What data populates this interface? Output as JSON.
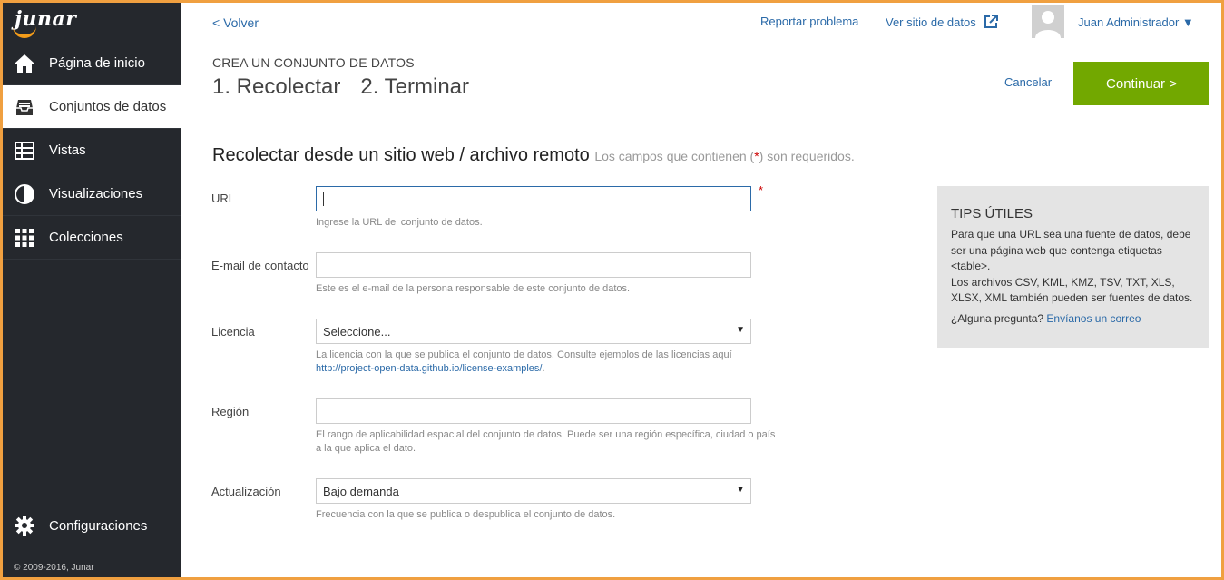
{
  "sidebar": {
    "logo": "junar",
    "items": [
      {
        "label": "Página de inicio",
        "icon": "home-icon"
      },
      {
        "label": "Conjuntos de datos",
        "icon": "inbox-icon"
      },
      {
        "label": "Vistas",
        "icon": "table-icon"
      },
      {
        "label": "Visualizaciones",
        "icon": "pie-chart-icon"
      },
      {
        "label": "Colecciones",
        "icon": "grid-icon"
      }
    ],
    "settings_label": "Configuraciones",
    "copyright": "© 2009-2016, Junar"
  },
  "header": {
    "back": "< Volver",
    "report": "Reportar problema",
    "view_site": "Ver sitio de datos",
    "user": "Juan Administrador ▼"
  },
  "wizard": {
    "subtitle": "CREA UN CONJUNTO DE DATOS",
    "step1": "1. Recolectar",
    "step2": "2. Terminar",
    "cancel": "Cancelar",
    "continue": "Continuar >"
  },
  "form": {
    "title": "Recolectar desde un sitio web / archivo remoto",
    "note_pre": "Los campos que contienen (",
    "note_req": "*",
    "note_post": ") son requeridos.",
    "url": {
      "label": "URL",
      "value": "",
      "help": "Ingrese la URL del conjunto de datos.",
      "required": "*"
    },
    "email": {
      "label": "E-mail de contacto",
      "value": "",
      "help": "Este es el e-mail de la persona responsable de este conjunto de datos."
    },
    "license": {
      "label": "Licencia",
      "selected": "Seleccione...",
      "help": "La licencia con la que se publica el conjunto de datos. Consulte ejemplos de las licencias aquí",
      "help_link": "http://project-open-data.github.io/license-examples/",
      "help_end": "."
    },
    "region": {
      "label": "Región",
      "value": "",
      "help": "El rango de aplicabilidad espacial del conjunto de datos. Puede ser una región específica, ciudad o país a la que aplica el dato."
    },
    "update": {
      "label": "Actualización",
      "selected": "Bajo demanda",
      "help": "Frecuencia con la que se publica o despublica el conjunto de datos."
    }
  },
  "tips": {
    "title": "TIPS ÚTILES",
    "body1": "Para que una URL sea una fuente de datos, debe ser una página web que contenga etiquetas <table>.",
    "body2": "Los archivos CSV, KML, KMZ, TSV, TXT, XLS, XLSX, XML también pueden ser fuentes de datos.",
    "question": "¿Alguna pregunta?",
    "link": "Envíanos un correo"
  }
}
